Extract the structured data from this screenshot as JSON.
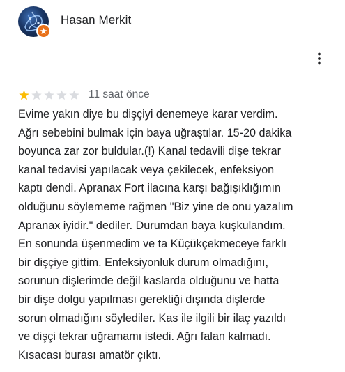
{
  "review": {
    "author": "Hasan Merkit",
    "rating": 1,
    "max_rating": 5,
    "time": "11 saat önce",
    "text_lines": [
      "Evime yakın diye bu dişçiyi denemeye karar verdim.",
      "Ağrı sebebini bulmak için baya uğraştılar. 15-20 dakika",
      "boyunca zar zor buldular.(!) Kanal tedavili dişe tekrar",
      "kanal tedavisi yapılacak veya çekilecek, enfeksiyon",
      "kaptı dendi. Apranax Fort ilacına karşı bağışıklığımın",
      "olduğunu söylememe rağmen \"Biz yine de onu yazalım",
      "Apranax iyidir.\" dediler. Durumdan baya kuşkulandım.",
      "En sonunda üşenmedim ve ta Küçükçekmeceye farklı",
      "bir dişçiye gittim. Enfeksiyonluk durum olmadığını,",
      "sorunun dişlerimde değil kaslarda olduğunu ve hatta",
      "bir dişe dolgu yapılması gerektiği dışında dişlerde",
      "sorun olmadığını söylediler. Kas ile ilgili bir ilaç yazıldı",
      "ve dişçi tekrar uğramamı istedi. Ağrı falan kalmadı.",
      "Kısacası burası amatör çıktı."
    ]
  },
  "icons": {
    "avatar_badge": "local-guide-star-icon",
    "menu": "more-vert-icon",
    "star": "star-icon"
  },
  "colors": {
    "star_filled": "#fbbc04",
    "star_empty": "#dadce0",
    "badge": "#e8711a",
    "secondary_text": "#5f6368"
  }
}
